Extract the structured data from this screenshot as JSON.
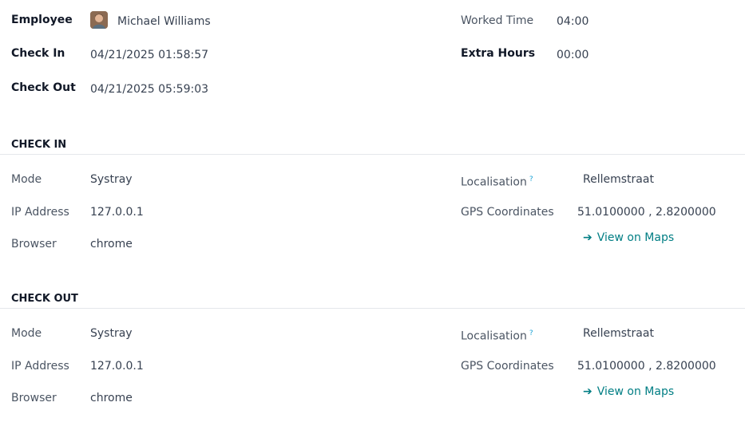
{
  "summary": {
    "employee_label": "Employee",
    "employee_name": "Michael Williams",
    "check_in_label": "Check In",
    "check_in_value": "04/21/2025 01:58:57",
    "check_out_label": "Check Out",
    "check_out_value": "04/21/2025 05:59:03",
    "worked_time_label": "Worked Time",
    "worked_time_value": "04:00",
    "extra_hours_label": "Extra Hours",
    "extra_hours_value": "00:00"
  },
  "check_in": {
    "title": "CHECK IN",
    "mode_label": "Mode",
    "mode_value": "Systray",
    "ip_label": "IP Address",
    "ip_value": "127.0.0.1",
    "browser_label": "Browser",
    "browser_value": "chrome",
    "localisation_label": "Localisation",
    "localisation_help": "?",
    "localisation_value": "Rellemstraat",
    "gps_label": "GPS Coordinates",
    "gps_value": "51.0100000 , 2.8200000",
    "maps_arrow": "➔",
    "maps_label": "View on Maps"
  },
  "check_out": {
    "title": "CHECK OUT",
    "mode_label": "Mode",
    "mode_value": "Systray",
    "ip_label": "IP Address",
    "ip_value": "127.0.0.1",
    "browser_label": "Browser",
    "browser_value": "chrome",
    "localisation_label": "Localisation",
    "localisation_help": "?",
    "localisation_value": "Rellemstraat",
    "gps_label": "GPS Coordinates",
    "gps_value": "51.0100000 , 2.8200000",
    "maps_arrow": "➔",
    "maps_label": "View on Maps"
  },
  "colors": {
    "link": "#017e84",
    "help": "#1aa2d6",
    "divider": "#e5e7eb"
  }
}
